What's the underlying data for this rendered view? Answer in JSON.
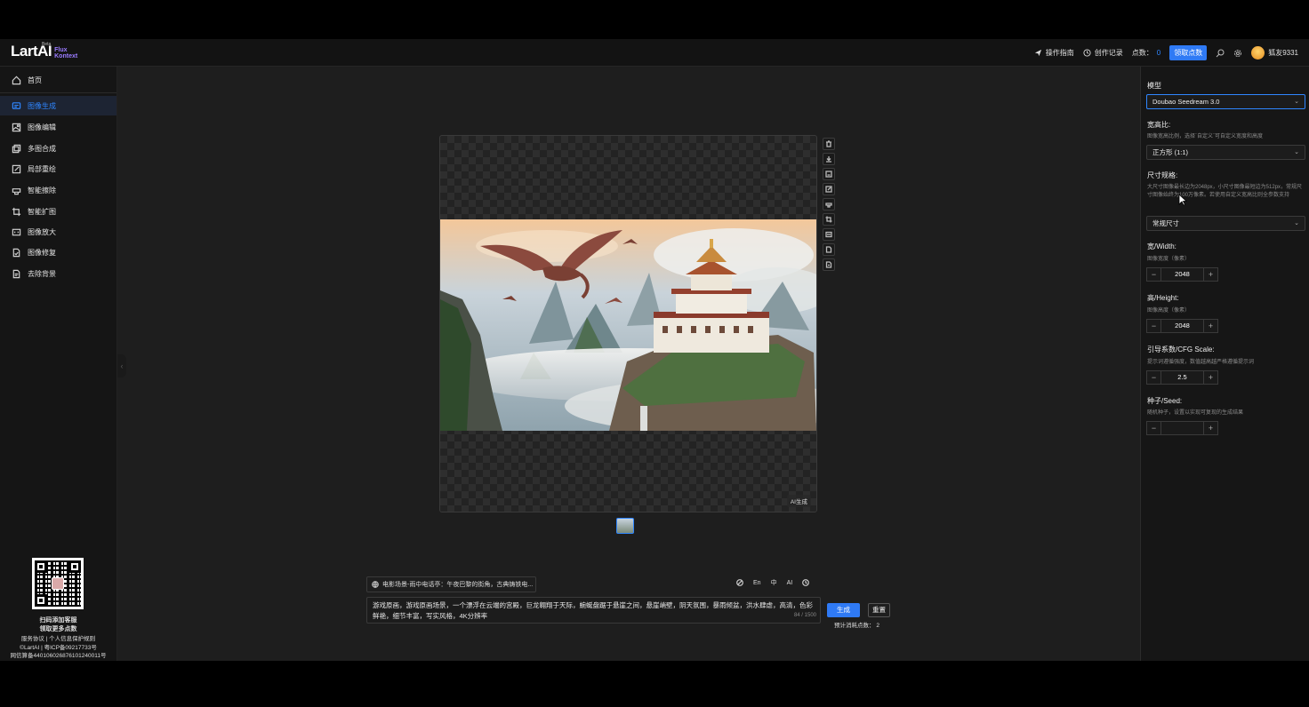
{
  "header": {
    "logo_main": "LartAI",
    "logo_sup": "Beta",
    "logo_sub_1": "Flux",
    "logo_sub_2": "Kontext",
    "guide_label": "操作指南",
    "history_label": "创作记录",
    "points_label": "点数：",
    "points_value": "0",
    "claim_label": "领取点数",
    "username": "狐友9331"
  },
  "sidebar": {
    "items": [
      {
        "label": "首页",
        "icon": "home-icon"
      },
      {
        "label": "图像生成",
        "icon": "image-gen-icon"
      },
      {
        "label": "图像编辑",
        "icon": "image-edit-icon"
      },
      {
        "label": "多图合成",
        "icon": "multi-image-icon"
      },
      {
        "label": "局部重绘",
        "icon": "inpaint-icon"
      },
      {
        "label": "智能擦除",
        "icon": "eraser-icon"
      },
      {
        "label": "智能扩图",
        "icon": "crop-icon"
      },
      {
        "label": "图像放大",
        "icon": "upscale-icon"
      },
      {
        "label": "图像修复",
        "icon": "repair-icon"
      },
      {
        "label": "去除背景",
        "icon": "remove-bg-icon"
      }
    ],
    "footer": {
      "line1": "扫码添加客服",
      "line2": "领取更多点数",
      "line3": "服务协议 | 个人信息保护规则",
      "line4": "©LartAI | 粤ICP备09217733号",
      "line5": "网信算备440106026876101240011号"
    }
  },
  "canvas": {
    "ai_tag": "AI生成"
  },
  "prompt": {
    "suggestion": "电影场景-雨中电话亭：午夜巴黎的街角，古典铸铁电...",
    "tool_en": "En",
    "tool_zh": "中",
    "tool_ai": "AI",
    "text": "游戏原画，游戏原画场景，一个漂浮在云端的宫殿，巨龙翱翔于天际，蜿蜒盘踞于悬崖之间，悬崖峭壁，阴天氛围，暴雨倾盆，洪水肆虐，高清，色彩鲜艳，细节丰富，写实风格，4K分辨率",
    "counter": "84 / 1500",
    "generate_label": "生成",
    "reset_label": "重置",
    "cost_label": "预计消耗点数：",
    "cost_value": "2"
  },
  "panel": {
    "model_label": "模型",
    "model_value": "Doubao Seedream 3.0",
    "ratio_label": "宽高比:",
    "ratio_hint": "图像宽高比例，选择`自定义`可自定义宽度和高度",
    "ratio_value": "正方形 (1:1)",
    "size_label": "尺寸规格:",
    "size_hint": "大尺寸图像最长边为2048px，小尺寸图像最短边为512px，常规尺寸图像始终为100万像素。若使用自定义宽高比则全参数支持",
    "size_value": "常规尺寸",
    "width_label": "宽/Width:",
    "width_hint": "图像宽度（像素）",
    "width_value": "2048",
    "height_label": "高/Height:",
    "height_hint": "图像高度（像素）",
    "height_value": "2048",
    "cfg_label": "引导系数/CFG Scale:",
    "cfg_hint": "提示词遵循强度，数值越高越严格遵循提示词",
    "cfg_value": "2.5",
    "seed_label": "种子/Seed:",
    "seed_hint": "随机种子，设置以实现可复现的生成结果",
    "seed_value": "",
    "minus": "−",
    "plus": "+"
  }
}
